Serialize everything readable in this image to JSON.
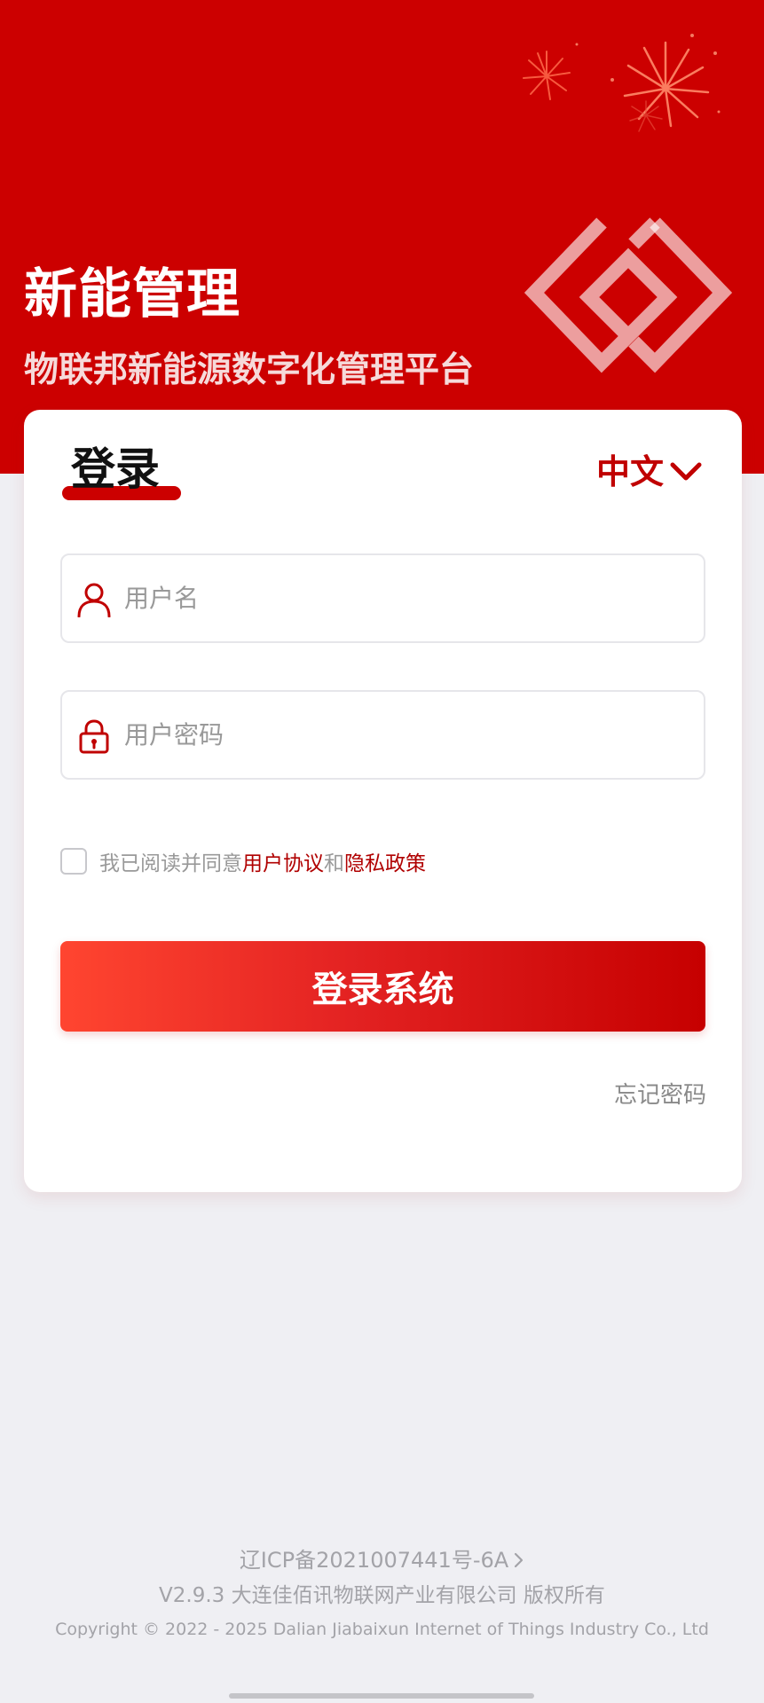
{
  "header": {
    "title": "新能管理",
    "subtitle": "物联邦新能源数字化管理平台",
    "logo_icon": "diamond-spiral-logo-icon",
    "decoration_icon": "fireworks-icon"
  },
  "login": {
    "title": "登录",
    "language": {
      "selected": "中文",
      "icon": "chevron-down-icon"
    },
    "username": {
      "placeholder": "用户名",
      "value": "",
      "icon": "user-icon"
    },
    "password": {
      "placeholder": "用户密码",
      "value": "",
      "icon": "lock-icon"
    },
    "agreement": {
      "checked": false,
      "prefix": "我已阅读并同意",
      "user_agreement": "用户协议",
      "conjunction": "和",
      "privacy_policy": "隐私政策"
    },
    "submit_label": "登录系统",
    "forgot_label": "忘记密码"
  },
  "footer": {
    "icp": "辽ICP备2021007441号-6A",
    "version_line": "V2.9.3 大连佳佰讯物联网产业有限公司 版权所有",
    "copyright": "Copyright © 2022 - 2025 Dalian Jiabaixun Internet of Things Industry Co., Ltd"
  },
  "colors": {
    "brand_red": "#cc0000",
    "link_red": "#b00000",
    "page_background": "#efeff3"
  }
}
